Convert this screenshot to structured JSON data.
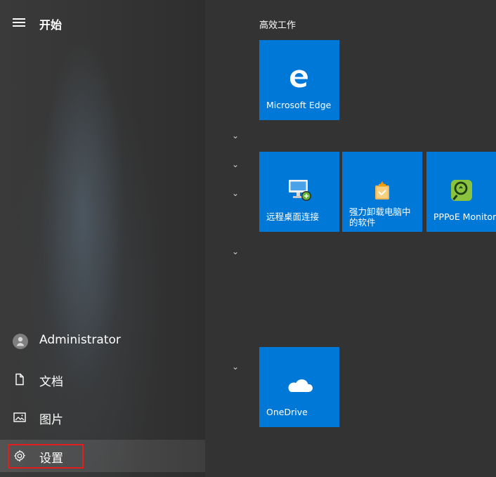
{
  "start": {
    "title": "开始"
  },
  "left_nav": {
    "user": "Administrator",
    "documents": "文档",
    "pictures": "图片",
    "settings": "设置"
  },
  "right_panel": {
    "group_title": "高效工作",
    "tiles": [
      {
        "label": "Microsoft Edge",
        "icon": "edge-icon"
      },
      {
        "label": "远程桌面连接",
        "icon": "remote-desktop-icon"
      },
      {
        "label": "强力卸载电脑中的软件",
        "icon": "uninstall-icon"
      },
      {
        "label": "PPPoE Monitor",
        "icon": "pppoe-monitor-icon"
      },
      {
        "label": "OneDrive",
        "icon": "onedrive-icon"
      }
    ]
  },
  "colors": {
    "tile_blue": "#0078d7",
    "panel_bg": "#333333",
    "highlight_red": "#e21d1d"
  }
}
